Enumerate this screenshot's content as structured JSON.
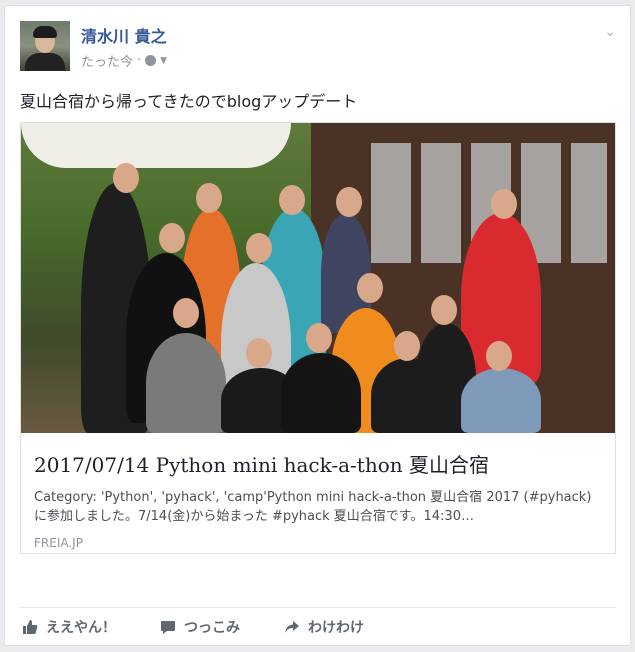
{
  "post": {
    "author": "清水川 貴之",
    "time": "たった今",
    "separator": "·",
    "status_text": "夏山合宿から帰ってきたのでblogアップデート"
  },
  "link": {
    "title": "2017/07/14 Python mini hack-a-thon 夏山合宿",
    "description": "Category: 'Python', 'pyhack', 'camp'Python mini hack-a-thon 夏山合宿 2017 (#pyhack) に参加しました。7/14(金)から始まった #pyhack 夏山合宿です。14:30…",
    "domain": "FREIA.JP"
  },
  "actions": {
    "like": "ええやん！",
    "comment": "つっこみ",
    "share": "わけわけ"
  },
  "icons": {
    "privacy": "globe-icon",
    "menu": "chevron-down-icon",
    "like": "thumbs-up-icon",
    "comment": "comment-icon",
    "share": "share-icon"
  }
}
